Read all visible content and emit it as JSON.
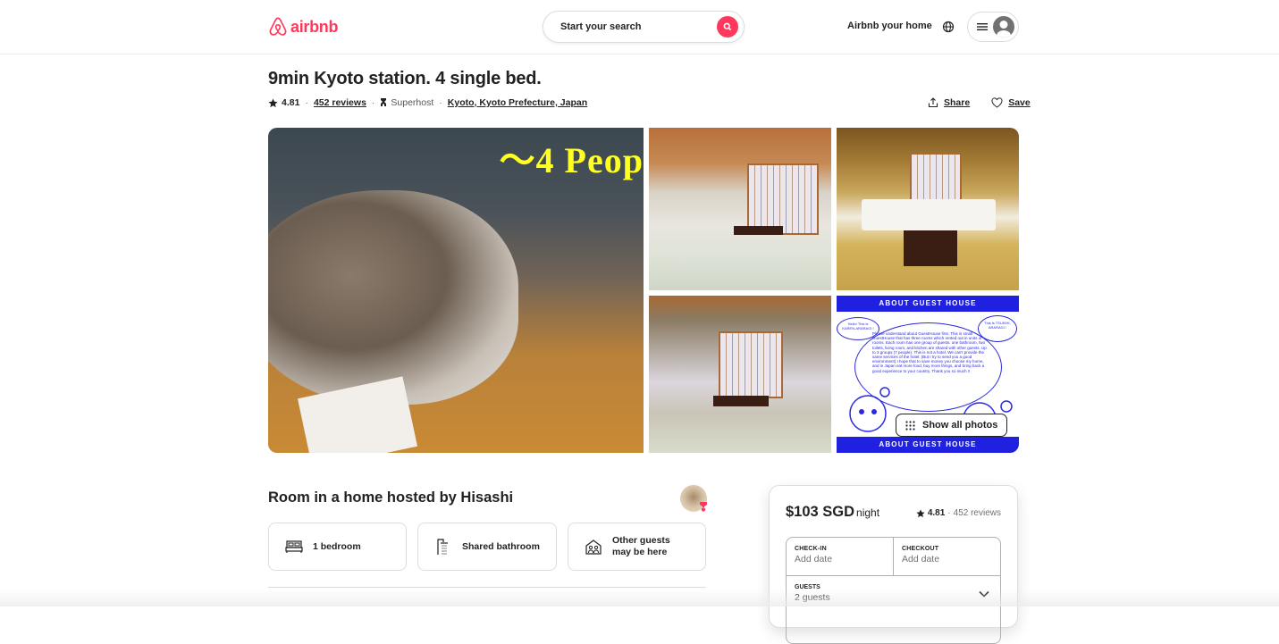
{
  "header": {
    "logo_text": "airbnb",
    "search_placeholder": "Start your search",
    "host_link": "Airbnb your home",
    "icons": {
      "logo": "airbnb-belo-icon",
      "search": "search-icon",
      "globe": "globe-icon",
      "menu": "hamburger-icon",
      "user": "user-avatar-icon"
    }
  },
  "listing": {
    "title": "9min Kyoto station. 4 single bed.",
    "rating": "4.81",
    "reviews": "452 reviews",
    "superhost": "Superhost",
    "location": "Kyoto, Kyoto Prefecture, Japan",
    "share_label": "Share",
    "save_label": "Save"
  },
  "gallery": {
    "main_caption": "～4 Peop",
    "about_banner": "ABOUT GUEST HOUSE",
    "comic_text": "Please understand about GuestHouse first. This is small GuestHouse that has three rooms which rented out in units of rooms. Each room has one group of guests. one bathroom, two toilets, living room, and kitchen are shared with other guests. Up to 3 groups (7 people). This is not a hotel. We can't provide the same services of the hotel. (But I try to send you a good environment) I hope that to save money you choose my home, and in Japan eat more food, buy more things, and bring back a good experience to your country. Thank you so much !!",
    "bubble_left": "Hello! This is KAREN-ARARAGI !",
    "bubble_right": "This is TSUKIHI-ARARAGI !",
    "show_all_label": "Show all photos"
  },
  "summary": {
    "title": "Room in a home hosted by Hisashi",
    "features": [
      {
        "icon": "bed-icon",
        "label": "1 bedroom"
      },
      {
        "icon": "shower-icon",
        "label": "Shared bathroom"
      },
      {
        "icon": "house-people-icon",
        "label_line1": "Other guests",
        "label_line2": "may be here"
      }
    ]
  },
  "booking": {
    "price": "$103 SGD",
    "per": "night",
    "rating": "4.81",
    "separator": "·",
    "reviews": "452 reviews",
    "checkin_label": "CHECK-IN",
    "checkin_value": "Add date",
    "checkout_label": "CHECKOUT",
    "checkout_value": "Add date",
    "guests_label": "GUESTS",
    "guests_value": "2 guests"
  },
  "colors": {
    "brand": "#ff385c",
    "text": "#222222",
    "muted": "#717171",
    "border": "#dddddd",
    "comic_blue": "#2020e0"
  }
}
